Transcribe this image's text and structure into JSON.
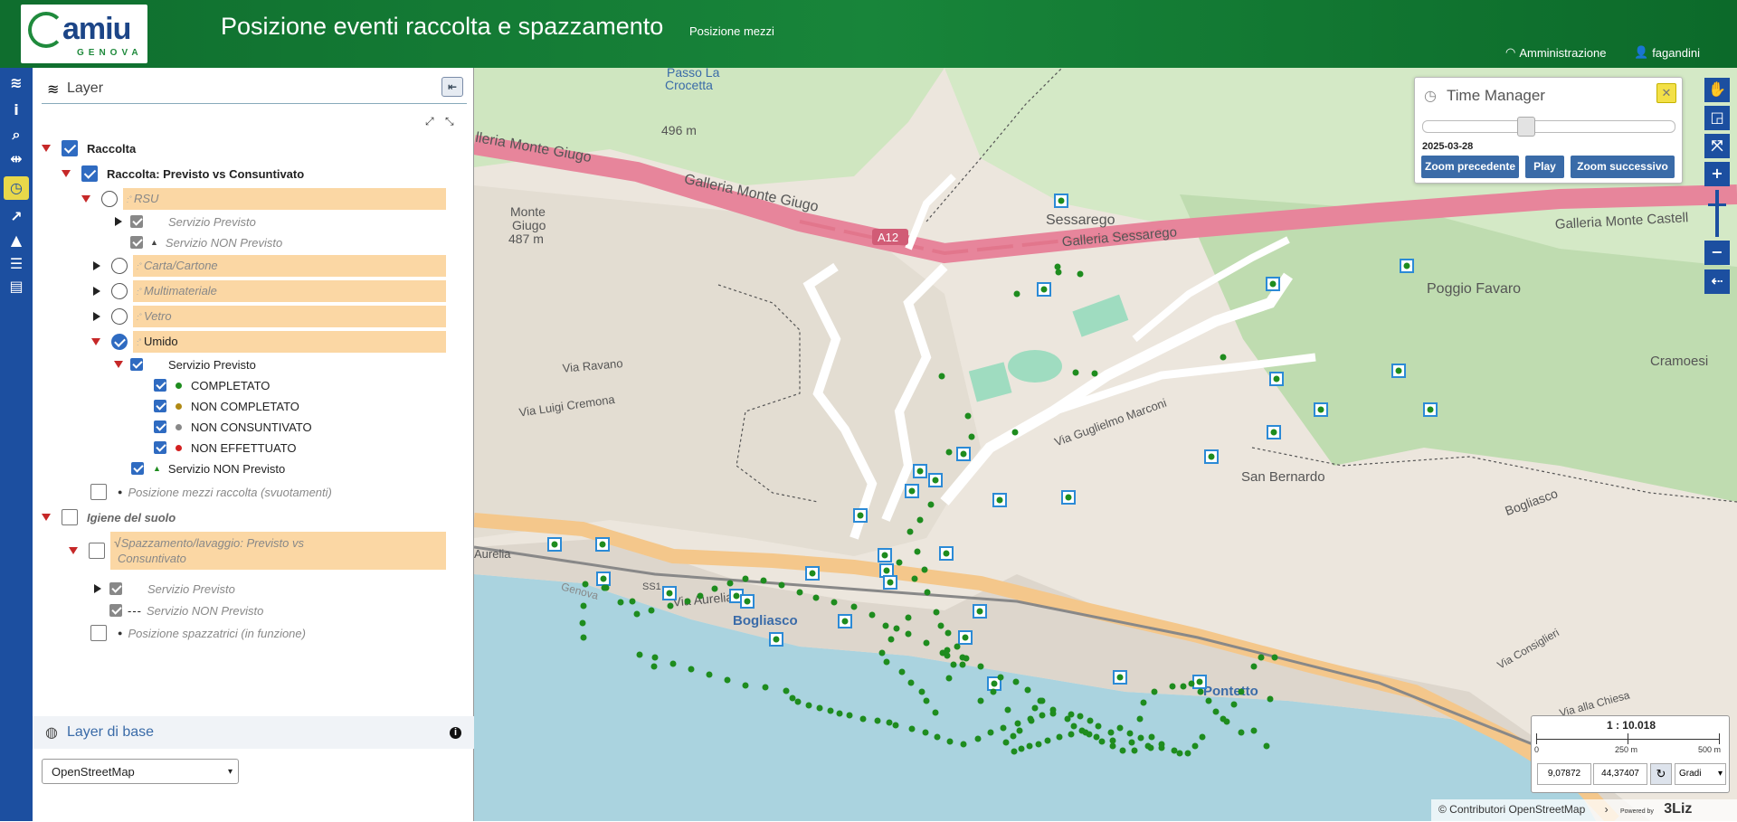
{
  "header": {
    "logo_text": "amiu",
    "logo_sub": "GENOVA",
    "title": "Posizione eventi raccolta e spazzamento",
    "subtitle": "Posizione mezzi",
    "admin_label": "Amministrazione",
    "user_label": "fagandini"
  },
  "panel": {
    "title": "Layer",
    "tree": {
      "raccolta": "Raccolta",
      "previsto_vs_consuntivato": "Raccolta: Previsto vs Consuntivato",
      "rsu": "RSU",
      "rsu_previsto": "Servizio Previsto",
      "rsu_non_previsto": "Servizio NON Previsto",
      "carta": "Carta/Cartone",
      "multimateriale": "Multimateriale",
      "vetro": "Vetro",
      "umido": "Umido",
      "umido_previsto": "Servizio Previsto",
      "completato": "COMPLETATO",
      "non_completato": "NON COMPLETATO",
      "non_consuntivato": "NON CONSUNTIVATO",
      "non_effettuato": "NON EFFETTUATO",
      "umido_non_previsto": "Servizio NON Previsto",
      "posizione_mezzi": "Posizione mezzi raccolta (svuotamenti)",
      "igiene": "Igiene del suolo",
      "spazzamento_l1": "Spazzamento/lavaggio: Previsto vs",
      "spazzamento_l2": "Consuntivato",
      "spazz_previsto": "Servizio Previsto",
      "spazz_non_previsto": "Servizio NON Previsto",
      "posizione_spazzatrici": "Posizione spazzatrici (in funzione)"
    },
    "base_layer_title": "Layer di base",
    "base_layer_selected": "OpenStreetMap"
  },
  "time_manager": {
    "title": "Time Manager",
    "date": "2025-03-28",
    "slider_position": 0.4,
    "buttons": [
      "Zoom precedente",
      "Play",
      "Zoom successivo"
    ]
  },
  "map_labels": {
    "passo": "Passo La",
    "crocetta": "Crocetta",
    "h496": "496 m",
    "monte_giugo": "Monte",
    "monte_giugo2": "Giugo",
    "monte_giugo3": "487 m",
    "galleria_giugo": "Galleria Monte Giugo",
    "galleria_monte_giugo_left": "lleria Monte Giugo",
    "a12": "A12",
    "sessarego": "Sessarego",
    "galleria_sessarego": "Galleria Sessarego",
    "galleria_castell": "Galleria Monte Castell",
    "poggio_favaro": "Poggio Favaro",
    "cramoesi": "Cramoesi",
    "via_ravano": "Via Ravano",
    "via_luigi_cremona": "Via Luigi Cremona",
    "via_aurelia": "Via Aurelia",
    "aurelia_left": "Aurelia",
    "bogliasco": "Bogliasco",
    "pontetto": "Pontetto",
    "san_bernardo": "San Bernardo",
    "via_marconi": "Via Guglielmo Marconi",
    "bogliasco_right": "Bogliasco",
    "via_consiglieri": "Via Consiglieri",
    "via_alla_chiesa": "Via alla Chiesa",
    "ss1": "SS1",
    "genova": "Genova"
  },
  "scale": {
    "ratio": "1 : 10.018",
    "ticks": [
      "0",
      "250 m",
      "500 m"
    ],
    "lon": "9,07872",
    "lat": "44,37407",
    "unit": "Gradi"
  },
  "attribution": "© Contributori OpenStreetMap",
  "powered_by": "Powered by",
  "lizmap": "3Liz",
  "colors": {
    "header_green": "#18853a",
    "iconbar_blue": "#1c4fa0",
    "highlight": "#fbd7a4",
    "dot_green": "#1e8c1e",
    "square_blue": "#2b8ad6"
  }
}
